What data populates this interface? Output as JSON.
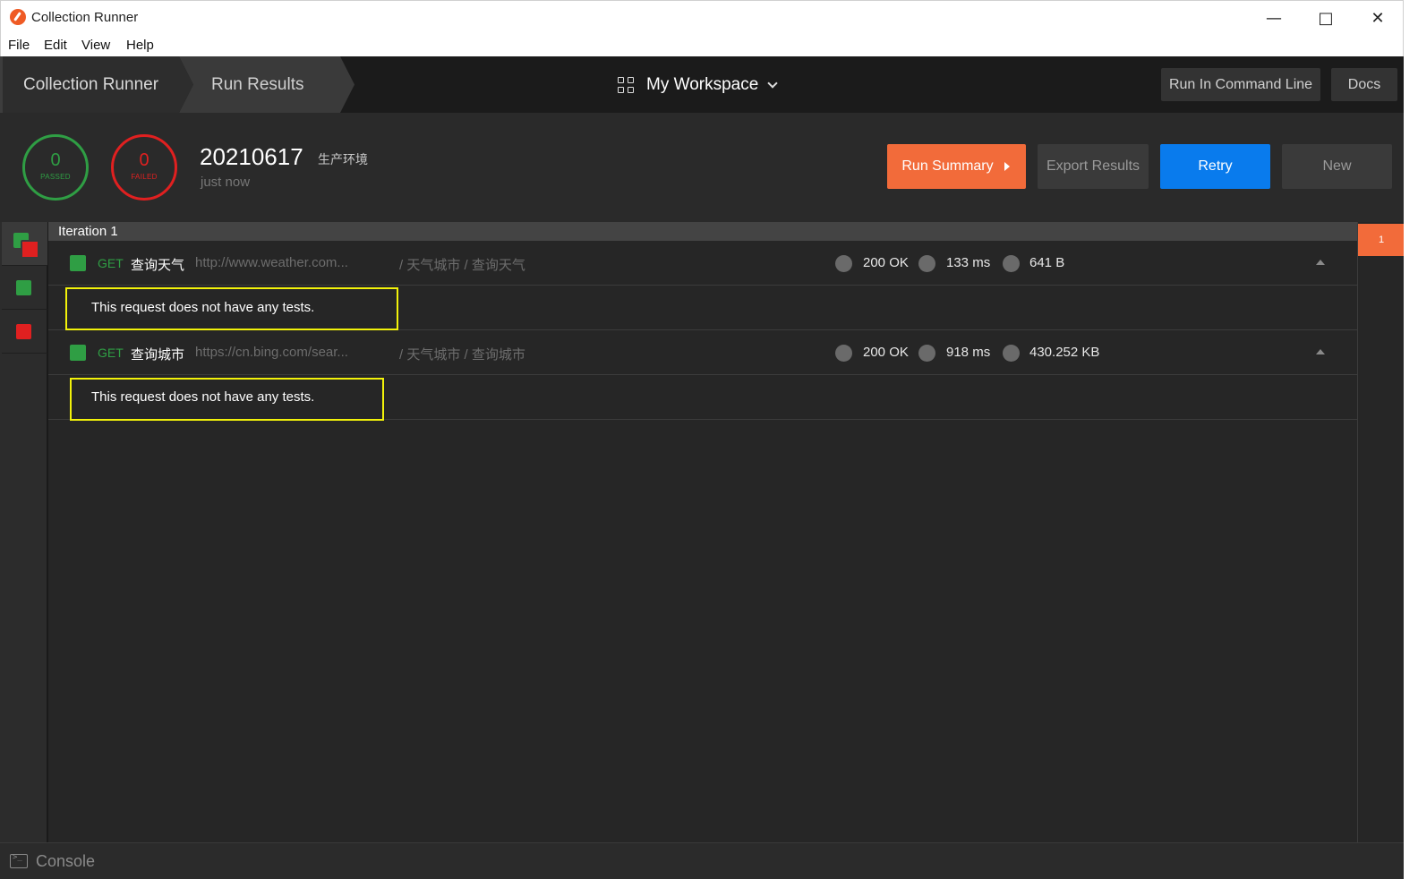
{
  "window": {
    "title": "Collection Runner"
  },
  "menu": [
    "File",
    "Edit",
    "View",
    "Help"
  ],
  "header": {
    "breadcrumb": [
      "Collection Runner",
      "Run Results"
    ],
    "workspace": "My Workspace",
    "run_cli_label": "Run In Command Line",
    "docs_label": "Docs"
  },
  "summary": {
    "passed_count": "0",
    "passed_label": "PASSED",
    "failed_count": "0",
    "failed_label": "FAILED",
    "run_name": "20210617",
    "environment": "生产环境",
    "time": "just now",
    "buttons": {
      "run_summary": "Run Summary",
      "export": "Export Results",
      "retry": "Retry",
      "new": "New"
    }
  },
  "iteration": {
    "label": "Iteration 1",
    "badge": "1",
    "requests": [
      {
        "method": "GET",
        "name": "查询天气",
        "url": "http://www.weather.com...",
        "path": "/ 天气城市 / 查询天气",
        "status": "200 OK",
        "time": "133 ms",
        "size": "641 B",
        "test_message": "This request does not have any tests."
      },
      {
        "method": "GET",
        "name": "查询城市",
        "url": "https://cn.bing.com/sear...",
        "path": "/ 天气城市 / 查询城市",
        "status": "200 OK",
        "time": "918 ms",
        "size": "430.252 KB",
        "test_message": "This request does not have any tests."
      }
    ]
  },
  "footer": {
    "console_label": "Console"
  },
  "colors": {
    "pass": "#2f9e44",
    "fail": "#e02020",
    "accent": "#f26b3a",
    "primary": "#097bed",
    "highlight": "#f2f20a"
  },
  "icons": [
    "postman-logo-icon",
    "minimize-icon",
    "maximize-icon",
    "close-icon",
    "workspace-grid-icon",
    "chevron-down-icon",
    "caret-right-icon",
    "collapse-up-icon",
    "console-icon"
  ]
}
